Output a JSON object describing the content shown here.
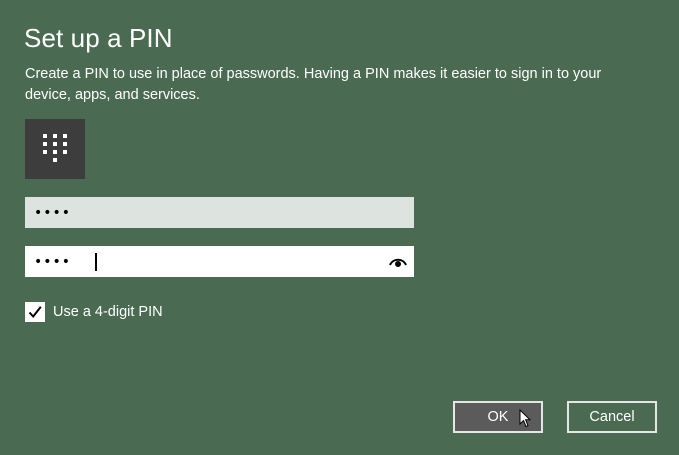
{
  "dialog": {
    "title": "Set up a PIN",
    "description": "Create a PIN to use in place of passwords. Having a PIN makes it easier to sign in to your device, apps, and services.",
    "keypad_icon": "keypad-icon",
    "fields": [
      {
        "value": "••••",
        "masked": true
      },
      {
        "value": "••••",
        "masked": true,
        "reveal_icon": "eye-icon"
      }
    ],
    "checkbox": {
      "label": "Use a 4-digit PIN",
      "checked": true
    },
    "buttons": {
      "ok_label": "OK",
      "cancel_label": "Cancel"
    }
  },
  "colors": {
    "background": "#4a6b52",
    "tile": "#3d3d3d",
    "field_inactive": "#dde3df",
    "field_active": "#ffffff",
    "ok_button": "#5b5b5b"
  }
}
